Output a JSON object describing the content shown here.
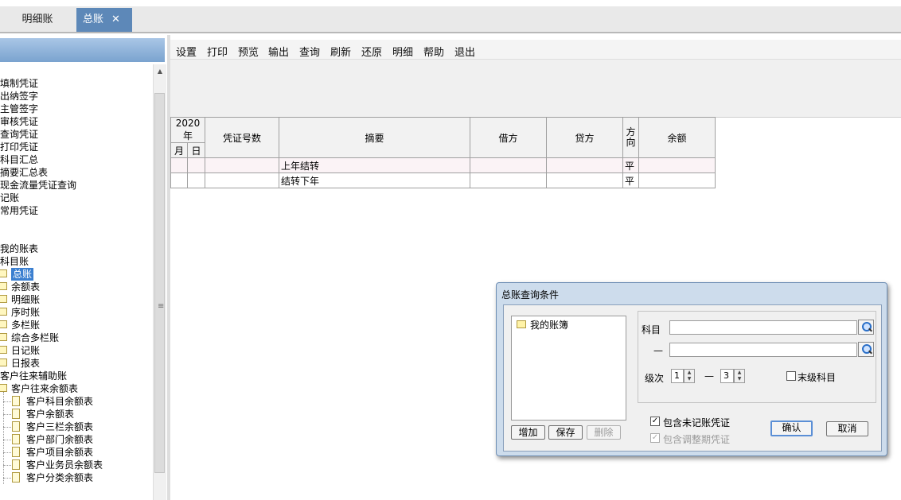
{
  "tabs": [
    {
      "label": "明细账"
    },
    {
      "label": "总账",
      "close": "✕"
    }
  ],
  "tree": {
    "items": [
      {
        "label": "",
        "indent": 0
      },
      {
        "label": "填制凭证",
        "indent": 0
      },
      {
        "label": "出纳签字",
        "indent": 0
      },
      {
        "label": "主管签字",
        "indent": 0
      },
      {
        "label": "审核凭证",
        "indent": 0
      },
      {
        "label": "查询凭证",
        "indent": 0
      },
      {
        "label": "打印凭证",
        "indent": 0
      },
      {
        "label": "科目汇总",
        "indent": 0
      },
      {
        "label": "摘要汇总表",
        "indent": 0
      },
      {
        "label": "现金流量凭证查询",
        "indent": 0
      },
      {
        "label": "记账",
        "indent": 0
      },
      {
        "label": "常用凭证",
        "indent": 0
      },
      {
        "label": "",
        "indent": 0
      },
      {
        "label": "",
        "indent": 0
      },
      {
        "label": "我的账表",
        "indent": 0
      },
      {
        "label": "科目账",
        "indent": 0
      },
      {
        "label": "总账",
        "indent": 1,
        "folder": true,
        "selected": true
      },
      {
        "label": "余额表",
        "indent": 1,
        "folder": true
      },
      {
        "label": "明细账",
        "indent": 1,
        "folder": true
      },
      {
        "label": "序时账",
        "indent": 1,
        "folder": true
      },
      {
        "label": "多栏账",
        "indent": 1,
        "folder": true
      },
      {
        "label": "综合多栏账",
        "indent": 1,
        "folder": true
      },
      {
        "label": "日记账",
        "indent": 1,
        "folder": true
      },
      {
        "label": "日报表",
        "indent": 1,
        "folder": true
      },
      {
        "label": "客户往来辅助账",
        "indent": 0
      },
      {
        "label": "客户往来余额表",
        "indent": 1,
        "folder": true
      },
      {
        "label": "客户科目余额表",
        "indent": 2,
        "doc": true
      },
      {
        "label": "客户余额表",
        "indent": 2,
        "doc": true
      },
      {
        "label": "客户三栏余额表",
        "indent": 2,
        "doc": true
      },
      {
        "label": "客户部门余额表",
        "indent": 2,
        "doc": true
      },
      {
        "label": "客户项目余额表",
        "indent": 2,
        "doc": true
      },
      {
        "label": "客户业务员余额表",
        "indent": 2,
        "doc": true
      },
      {
        "label": "客户分类余额表",
        "indent": 2,
        "doc": true
      }
    ]
  },
  "toolbar": {
    "items": [
      "设置",
      "打印",
      "预览",
      "输出",
      "查询",
      "刷新",
      "还原",
      "明细",
      "帮助",
      "退出"
    ]
  },
  "ledger": {
    "year": "2020年",
    "month": "月",
    "day": "日",
    "headers": {
      "voucher": "凭证号数",
      "summary": "摘要",
      "debit": "借方",
      "credit": "贷方",
      "direction": "方向",
      "balance": "余额"
    },
    "rows": [
      {
        "summary": "上年结转",
        "direction": "平"
      },
      {
        "summary": "结转下年",
        "direction": "平"
      }
    ]
  },
  "dialog": {
    "title": "总账查询条件",
    "book": "我的账簿",
    "add": "增加",
    "save": "保存",
    "delete": "删除",
    "subject_label": "科目",
    "dash": "—",
    "subject_from": "",
    "subject_to": "",
    "level_label": "级次",
    "level_from": "1",
    "level_to": "3",
    "leaf_label": "末级科目",
    "include_unposted": "包含未记账凭证",
    "include_adjust": "包含调整期凭证",
    "ok": "确认",
    "cancel": "取消"
  }
}
